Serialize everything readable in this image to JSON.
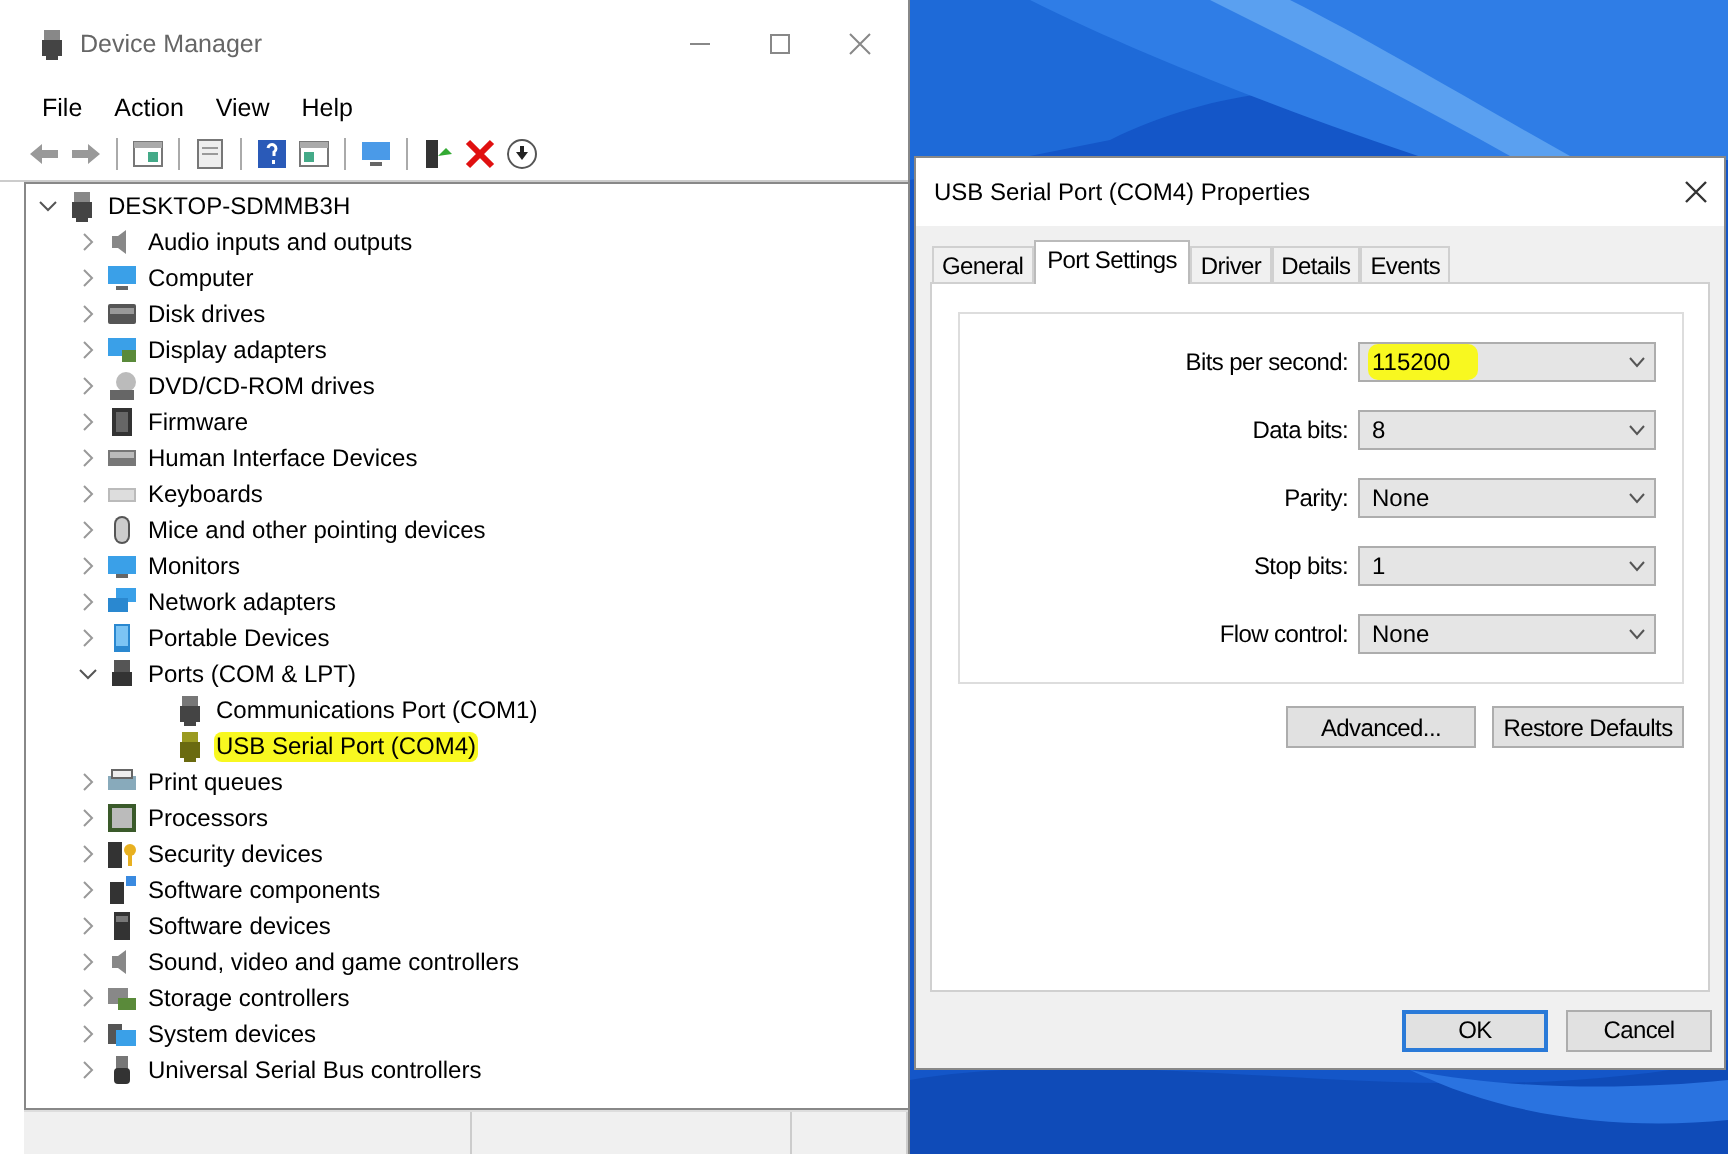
{
  "device_manager": {
    "title": "Device Manager",
    "menu": [
      "File",
      "Action",
      "View",
      "Help"
    ],
    "tree": {
      "label": "DESKTOP-SDMMB3H",
      "expanded": true,
      "children": [
        {
          "label": "Audio inputs and outputs",
          "expanded": false
        },
        {
          "label": "Computer",
          "expanded": false
        },
        {
          "label": "Disk drives",
          "expanded": false
        },
        {
          "label": "Display adapters",
          "expanded": false
        },
        {
          "label": "DVD/CD-ROM drives",
          "expanded": false
        },
        {
          "label": "Firmware",
          "expanded": false
        },
        {
          "label": "Human Interface Devices",
          "expanded": false
        },
        {
          "label": "Keyboards",
          "expanded": false
        },
        {
          "label": "Mice and other pointing devices",
          "expanded": false
        },
        {
          "label": "Monitors",
          "expanded": false
        },
        {
          "label": "Network adapters",
          "expanded": false
        },
        {
          "label": "Portable Devices",
          "expanded": false
        },
        {
          "label": "Ports (COM & LPT)",
          "expanded": true,
          "children": [
            {
              "label": "Communications Port (COM1)",
              "highlighted": false
            },
            {
              "label": "USB Serial Port (COM4)",
              "highlighted": true
            }
          ]
        },
        {
          "label": "Print queues",
          "expanded": false
        },
        {
          "label": "Processors",
          "expanded": false
        },
        {
          "label": "Security devices",
          "expanded": false
        },
        {
          "label": "Software components",
          "expanded": false
        },
        {
          "label": "Software devices",
          "expanded": false
        },
        {
          "label": "Sound, video and game controllers",
          "expanded": false
        },
        {
          "label": "Storage controllers",
          "expanded": false
        },
        {
          "label": "System devices",
          "expanded": false
        },
        {
          "label": "Universal Serial Bus controllers",
          "expanded": false
        }
      ]
    }
  },
  "dialog": {
    "title": "USB Serial Port (COM4) Properties",
    "tabs": [
      {
        "label": "General",
        "selected": false
      },
      {
        "label": "Port Settings",
        "selected": true
      },
      {
        "label": "Driver",
        "selected": false
      },
      {
        "label": "Details",
        "selected": false
      },
      {
        "label": "Events",
        "selected": false
      }
    ],
    "fields": [
      {
        "label": "Bits per second:",
        "value": "115200",
        "highlighted": true
      },
      {
        "label": "Data bits:",
        "value": "8",
        "highlighted": false
      },
      {
        "label": "Parity:",
        "value": "None",
        "highlighted": false
      },
      {
        "label": "Stop bits:",
        "value": "1",
        "highlighted": false
      },
      {
        "label": "Flow control:",
        "value": "None",
        "highlighted": false
      }
    ],
    "buttons": [
      "Advanced...",
      "Restore Defaults"
    ],
    "footer_buttons": [
      {
        "label": "OK",
        "default": true
      },
      {
        "label": "Cancel",
        "default": false
      }
    ]
  }
}
